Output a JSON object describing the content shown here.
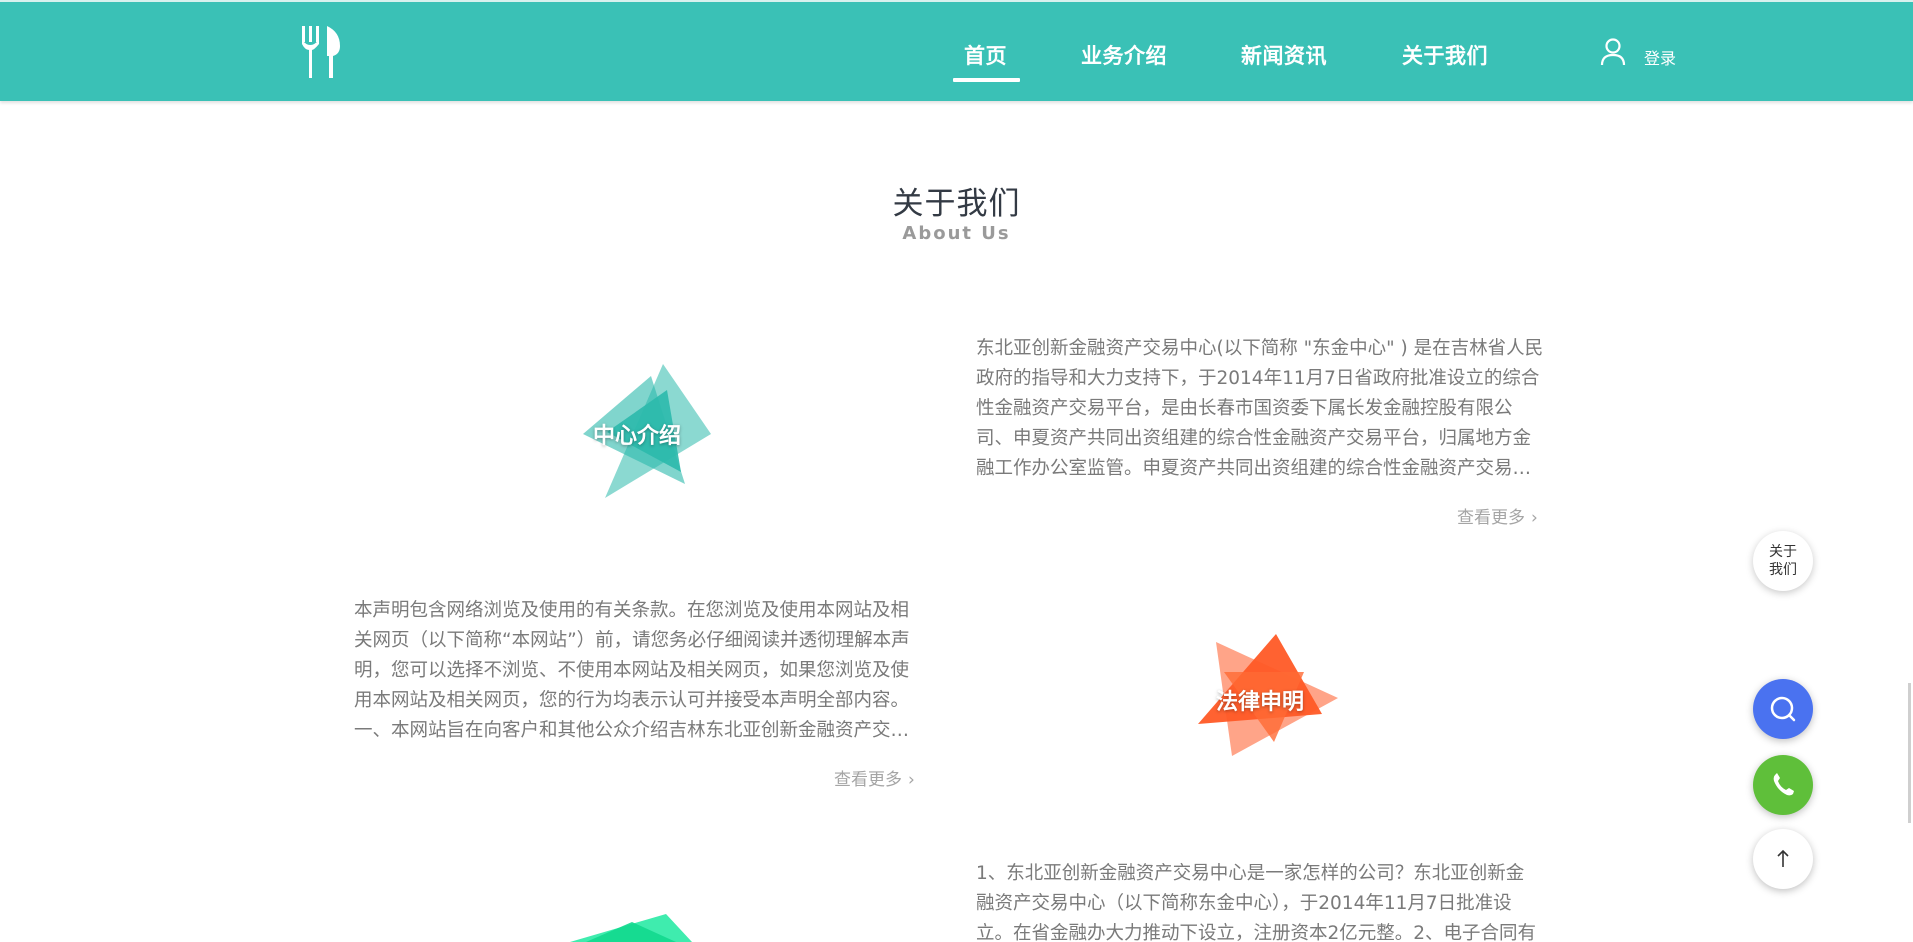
{
  "header": {
    "nav": [
      "首页",
      "业务介绍",
      "新闻资讯",
      "关于我们"
    ],
    "active_index": 0,
    "login_label": "登录",
    "colors": {
      "bar": "#3ac1b6",
      "text": "#ffffff"
    }
  },
  "section": {
    "title": "关于我们",
    "subtitle": "About Us"
  },
  "cards": [
    {
      "label": "中心介绍",
      "color": "#2bb9ac",
      "lines": [
        "东北亚创新金融资产交易中心(以下简称 \"东金中心\" ) 是在吉林省人民",
        "政府的指导和大力支持下，于2014年11月7日省政府批准设立的综合",
        "性金融资产交易平台，是由长春市国资委下属长发金融控股有限公",
        "司、申夏资产共同出资组建的综合性金融资产交易平台，归属地方金",
        "融工作办公室监管。申夏资产共同出资组建的综合性金融资产交易…"
      ],
      "more": "查看更多"
    },
    {
      "label": "法律申明",
      "color": "#ff5a26",
      "lines": [
        "本声明包含网络浏览及使用的有关条款。在您浏览及使用本网站及相",
        "关网页（以下简称“本网站”）前，请您务必仔细阅读并透彻理解本声",
        "明，您可以选择不浏览、不使用本网站及相关网页，如果您浏览及使",
        "用本网站及相关网页，您的行为均表示认可并接受本声明全部内容。",
        "一、本网站旨在向客户和其他公众介绍吉林东北亚创新金融资产交…"
      ],
      "more": "查看更多"
    },
    {
      "label": "",
      "color": "#1de9a0",
      "lines": [
        "1、东北亚创新金融资产交易中心是一家怎样的公司？东北亚创新金",
        "融资产交易中心（以下简称东金中心），于2014年11月7日批准设",
        "立。在省金融办大力推动下设立，注册资本2亿元整。2、电子合同有"
      ]
    }
  ],
  "floating": {
    "about_line1": "关于",
    "about_line2": "我们",
    "search_color": "#4a72f0",
    "phone_color": "#5fbf3a"
  }
}
